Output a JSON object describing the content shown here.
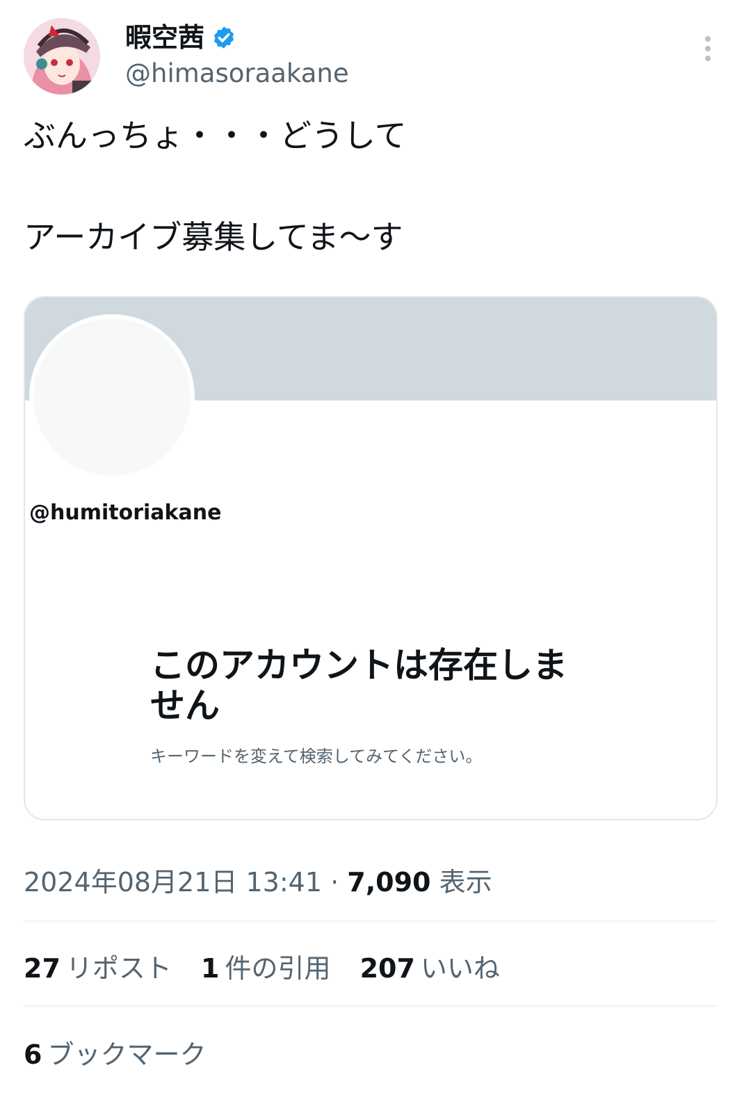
{
  "author": {
    "display_name": "暇空茜",
    "handle": "@himasoraakane",
    "verified": true,
    "avatar_icon": "anime-avatar-image",
    "verified_icon": "verified-badge-icon",
    "verified_color": "#1d9bf0"
  },
  "tweet": {
    "line1": "ぶんっちょ・・・どうして",
    "line2": "アーカイブ募集してま〜す"
  },
  "embedded_card": {
    "handle": "@humitoriakane",
    "title": "このアカウントは存在しません",
    "subtitle": "キーワードを変えて検索してみてください。",
    "banner_color": "#cfd9de"
  },
  "meta": {
    "timestamp": "2024年08月21日 13:41",
    "separator": "·",
    "views": "7,090",
    "views_label": "表示"
  },
  "stats": {
    "reposts": "27",
    "reposts_label": "リポスト",
    "quotes": "1",
    "quotes_label": "件の引用",
    "likes": "207",
    "likes_label": "いいね",
    "bookmarks": "6",
    "bookmarks_label": "ブックマーク"
  }
}
